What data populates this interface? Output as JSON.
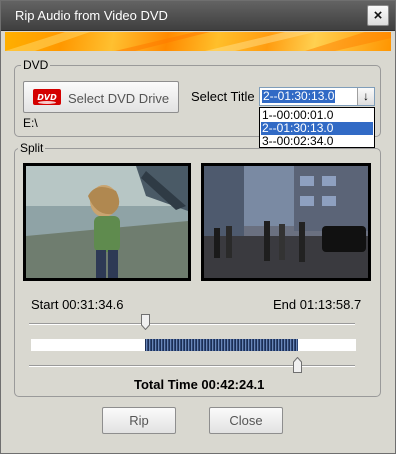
{
  "window": {
    "title": "Rip Audio from Video DVD",
    "close_glyph": "×"
  },
  "dvd": {
    "legend": "DVD",
    "select_drive_label": "Select DVD Drive",
    "drive_path": "E:\\",
    "select_title_label": "Select Title",
    "combo_value": "2--01:30:13.0",
    "arrow_glyph": "↓",
    "title_options": [
      "1--00:00:01.0",
      "2--01:30:13.0",
      "3--00:02:34.0"
    ],
    "selected_option_index": 1
  },
  "split": {
    "legend": "Split",
    "start_label": "Start 00:31:34.6",
    "end_label": "End 01:13:58.7",
    "total_time_label": "Total Time 00:42:24.1",
    "start_position_fraction": 0.357,
    "end_position_fraction": 0.823
  },
  "actions": {
    "rip_label": "Rip",
    "close_label": "Close"
  },
  "colors": {
    "selection": "#316ac5",
    "banner_orange": "#ff9800",
    "titlebar": "#4a4a4a"
  }
}
